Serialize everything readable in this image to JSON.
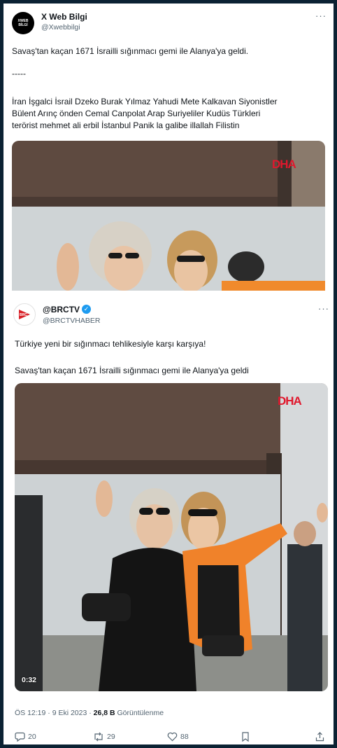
{
  "tweet1": {
    "author_name": "X Web Bilgi",
    "author_handle": "@Xwebbilgi",
    "avatar_text": "XWEB BİLGİ",
    "line1": "Savaş'tan kaçan 1671 İsrailli sığınmacı gemi ile Alanya'ya geldi.",
    "separator": "-----",
    "line2": "İran İşgalci İsrail Dzeko Burak Yılmaz Yahudi Mete Kalkavan Siyonistler",
    "line3": "Bülent Arınç önden Cemal Canpolat Arap Suriyeliler Kudüs Türkleri",
    "line4": "terörist mehmet ali erbil İstanbul  Panik la galibe illallah Filistin",
    "watermark": "DHA"
  },
  "tweet2": {
    "author_name": "@BRCTV",
    "author_handle": "@BRCTVHABER",
    "avatar_text": "BRC",
    "verified": true,
    "line1": "Türkiye yeni bir sığınmacı tehlikesiyle karşı karşıya!",
    "line2": "Savaş'tan kaçan 1671 İsrailli sığınmacı gemi ile Alanya'ya geldi",
    "watermark": "DHA",
    "video_duration": "0:32",
    "timestamp": "ÖS 12:19 · 9 Eki 2023 · ",
    "views_count": "26,8 B",
    "views_label": " Görüntülenme",
    "replies": "20",
    "reposts": "29",
    "likes": "88"
  },
  "colors": {
    "accent": "#1d9bf0",
    "brand_red": "#e0182d",
    "frame": "#0b2233"
  }
}
